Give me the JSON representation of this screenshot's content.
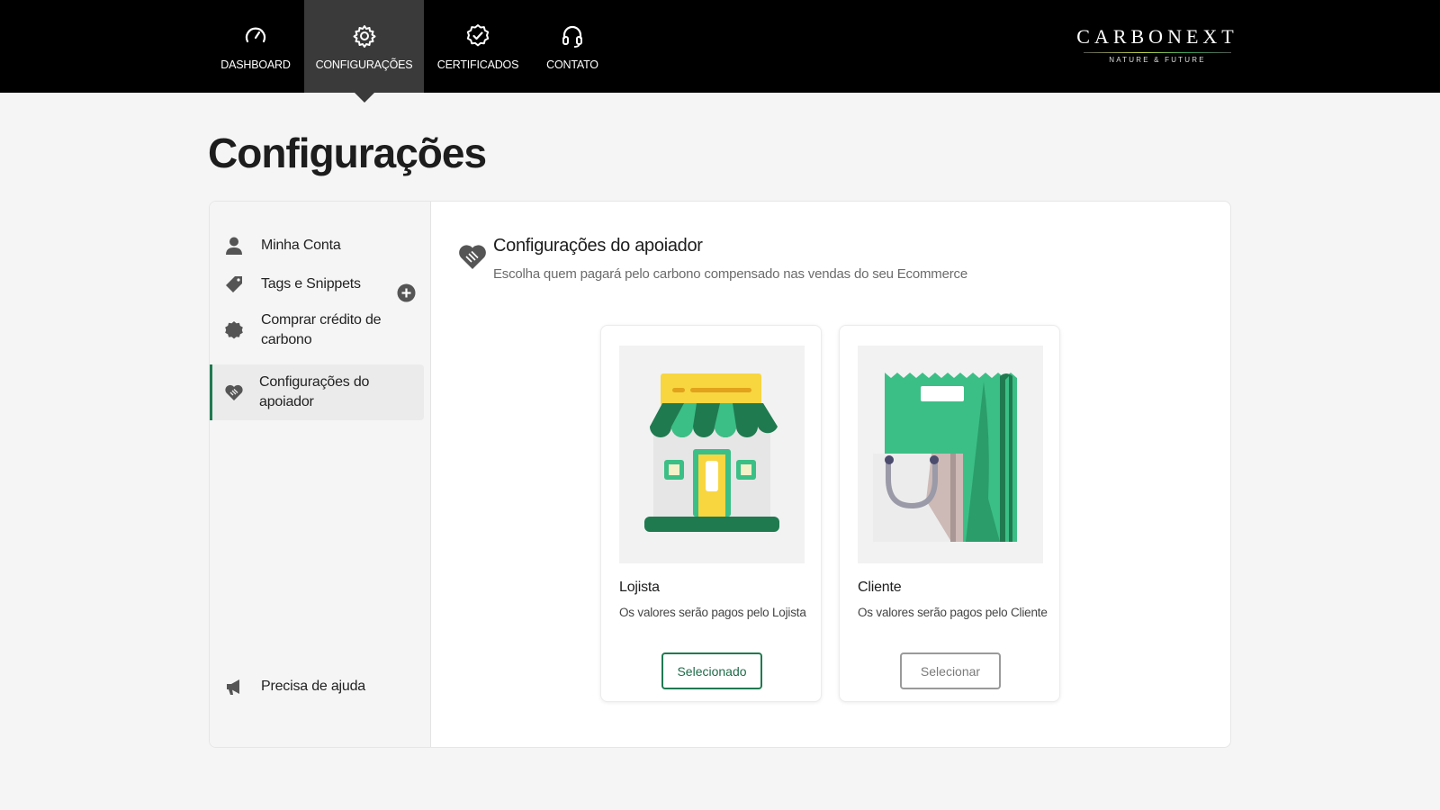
{
  "nav": {
    "items": [
      {
        "label": "DASHBOARD",
        "icon": "speedometer-icon"
      },
      {
        "label": "CONFIGURAÇÕES",
        "icon": "gear-icon",
        "active": true
      },
      {
        "label": "CERTIFICADOS",
        "icon": "check-badge-icon"
      },
      {
        "label": "CONTATO",
        "icon": "headset-icon"
      }
    ]
  },
  "logo": {
    "word": "CARBONEXT",
    "tagline": "NATURE & FUTURE"
  },
  "page": {
    "title": "Configurações"
  },
  "sidebar": {
    "items": [
      {
        "label": "Minha Conta",
        "icon": "user-icon"
      },
      {
        "label": "Tags e Snippets",
        "icon": "tag-icon",
        "action_icon": "plus-circle-icon"
      },
      {
        "label": "Comprar crédito de carbono",
        "icon": "badge-icon"
      },
      {
        "label": "Configurações do apoiador",
        "icon": "heart-handshake-icon",
        "active": true
      }
    ],
    "help": {
      "label": "Precisa de ajuda",
      "icon": "megaphone-icon"
    }
  },
  "section": {
    "title": "Configurações do apoiador",
    "subtitle": "Escolha quem pagará pelo carbono compensado nas vendas do seu Ecommerce",
    "icon": "heart-handshake-icon"
  },
  "cards": [
    {
      "name": "Lojista",
      "description": "Os valores serão pagos pelo Lojista",
      "button": "Selecionado",
      "selected": true,
      "illustration": "storefront-illustration"
    },
    {
      "name": "Cliente",
      "description": "Os valores serão pagos pelo Cliente",
      "button": "Selecionar",
      "selected": false,
      "illustration": "shopping-bag-illustration"
    }
  ],
  "colors": {
    "accent": "#1f7a50",
    "topbar": "#000000",
    "active_tab": "#3a3a3a",
    "green": "#3bbf86",
    "dark_green": "#1f7a50",
    "yellow": "#f7d640"
  }
}
